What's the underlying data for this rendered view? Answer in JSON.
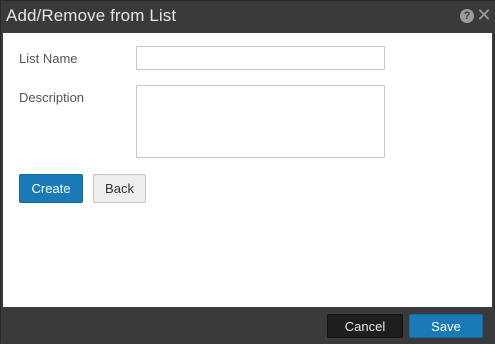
{
  "dialog": {
    "title": "Add/Remove from List"
  },
  "icons": {
    "help": "question-circle-icon",
    "close": "close-icon"
  },
  "form": {
    "list_name_label": "List Name",
    "list_name_value": "",
    "description_label": "Description",
    "description_value": ""
  },
  "actions": {
    "create_label": "Create",
    "back_label": "Back"
  },
  "footer": {
    "cancel_label": "Cancel",
    "save_label": "Save"
  },
  "colors": {
    "primary": "#1a7ab8",
    "chrome": "#3a3a3a",
    "dark_button": "#1e1e1e"
  }
}
